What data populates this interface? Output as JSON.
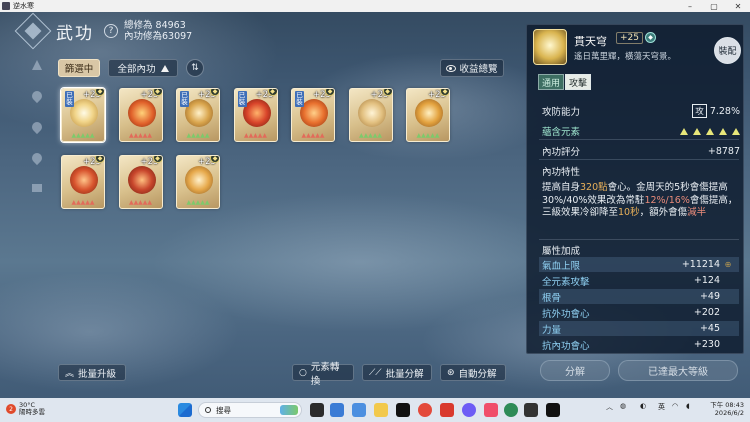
{
  "window": {
    "title": "逆水寒"
  },
  "header": {
    "title": "武功",
    "stat_total_label": "總修為 84963",
    "stat_inner_label": "內功修為63097"
  },
  "filters": {
    "selecting_label": "篩選中",
    "all_label": "全部內功",
    "overview_label": "收益總覽"
  },
  "grid": {
    "cards": [
      {
        "level": "+25",
        "equipped": "已裝",
        "stars": "▲▲▲▲▲",
        "star_color": "green"
      },
      {
        "level": "+25",
        "equipped": "",
        "stars": "▲▲▲▲▲",
        "star_color": "red"
      },
      {
        "level": "+25",
        "equipped": "已裝",
        "stars": "▲▲▲▲▲",
        "star_color": "green"
      },
      {
        "level": "+25",
        "equipped": "已裝",
        "stars": "▲▲▲▲▲",
        "star_color": "red"
      },
      {
        "level": "+25",
        "equipped": "已裝",
        "stars": "▲▲▲▲▲",
        "star_color": "red"
      },
      {
        "level": "+25",
        "equipped": "",
        "stars": "▲▲▲▲▲",
        "star_color": "green"
      },
      {
        "level": "+25",
        "equipped": "",
        "stars": "▲▲▲▲▲",
        "star_color": "green"
      },
      {
        "level": "+25",
        "equipped": "",
        "stars": "▲▲▲▲▲",
        "star_color": "red"
      },
      {
        "level": "+25",
        "equipped": "",
        "stars": "▲▲▲▲▲",
        "star_color": "red"
      },
      {
        "level": "+25",
        "equipped": "",
        "stars": "▲▲▲▲▲",
        "star_color": "green"
      }
    ]
  },
  "bottom_buttons": {
    "batch_upgrade": "批量升級",
    "element_convert": "元素轉換",
    "batch_decompose": "批量分解",
    "auto_decompose": "自動分解"
  },
  "panel": {
    "item_name": "貫天穹",
    "item_level": "+25",
    "item_desc": "遙日萬里輝，橫蕩天穹景。",
    "equip_label": "裝配",
    "tab_general": "通用",
    "tab_attack": "攻擊",
    "attack_label": "攻防能力",
    "attack_mark": "攻",
    "attack_value": "7.28%",
    "element_label": "蘊含元素",
    "inner_score_label": "內功評分",
    "inner_score_value": "+8787",
    "trait_label": "內功特性",
    "desc_1": "提高自身",
    "desc_hl1": "320點",
    "desc_2": "會心。金周天的5秒會傷提高30%/40%效果改為常駐",
    "desc_hl2": "12%/16%",
    "desc_3": "會傷提高，三級效果冷卻降至",
    "desc_hl3": "10秒",
    "desc_4": "，額外會傷",
    "desc_hl4": "減半",
    "attr_title": "屬性加成",
    "attributes": [
      {
        "name": "氣血上限",
        "value": "+11214"
      },
      {
        "name": "全元素攻擊",
        "value": "+124"
      },
      {
        "name": "根骨",
        "value": "+49"
      },
      {
        "name": "抗外功會心",
        "value": "+202"
      },
      {
        "name": "力量",
        "value": "+45"
      },
      {
        "name": "抗內功會心",
        "value": "+230"
      }
    ],
    "decompose_label": "分解",
    "max_level_label": "已達最大等級"
  },
  "taskbar": {
    "temp": "30°C",
    "weather": "陽時多雲",
    "search_placeholder": "搜尋",
    "ime": "英",
    "time": "下午 08:43",
    "date": "2026/6/2"
  }
}
